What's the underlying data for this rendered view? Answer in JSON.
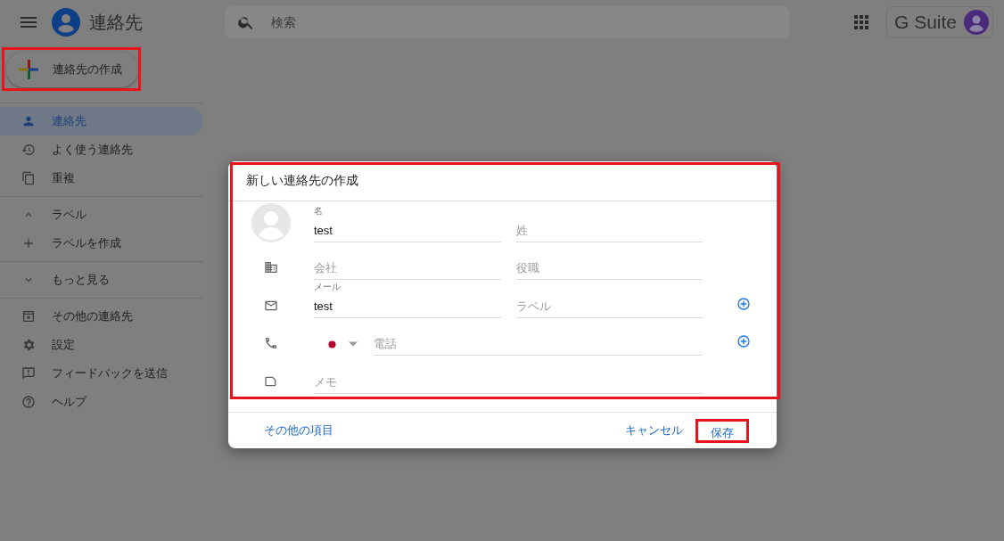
{
  "header": {
    "title": "連絡先",
    "search": {
      "placeholder": "検索"
    },
    "suite_label": "G Suite"
  },
  "create_button": {
    "label": "連絡先の作成",
    "highlighted": true
  },
  "sidebar": {
    "sections": [
      {
        "items": [
          {
            "label": "連絡先",
            "selected": true
          },
          {
            "label": "よく使う連絡先",
            "selected": false
          },
          {
            "label": "重複",
            "selected": false
          }
        ]
      },
      {
        "items": [
          {
            "label": "ラベル",
            "kind": "toggle",
            "expanded": true
          },
          {
            "label": "ラベルを作成",
            "kind": "add"
          }
        ]
      },
      {
        "items": [
          {
            "label": "もっと見る",
            "kind": "toggle",
            "expanded": false
          }
        ]
      },
      {
        "items": [
          {
            "label": "その他の連絡先",
            "selected": false
          },
          {
            "label": "設定",
            "selected": false
          },
          {
            "label": "フィードバックを送信",
            "selected": false
          },
          {
            "label": "ヘルプ",
            "selected": false
          }
        ]
      }
    ]
  },
  "dialog": {
    "title": "新しい連絡先の作成",
    "highlighted": true,
    "rows": [
      {
        "kind": "name",
        "fields": [
          {
            "label": "名",
            "value": "test"
          },
          {
            "placeholder": "姓"
          }
        ]
      },
      {
        "kind": "company",
        "fields": [
          {
            "placeholder": "会社"
          },
          {
            "placeholder": "役職"
          }
        ]
      },
      {
        "kind": "email",
        "fields": [
          {
            "label": "メール",
            "value": "test"
          },
          {
            "placeholder": "ラベル"
          }
        ],
        "addable": true
      },
      {
        "kind": "phone",
        "fields": [
          {
            "placeholder": "電話"
          }
        ],
        "addable": true
      },
      {
        "kind": "memo",
        "fields": [
          {
            "placeholder": "メモ"
          }
        ]
      }
    ],
    "more_link": "その他の項目",
    "cancel": "キャンセル",
    "save": {
      "label": "保存",
      "highlighted": true
    }
  }
}
